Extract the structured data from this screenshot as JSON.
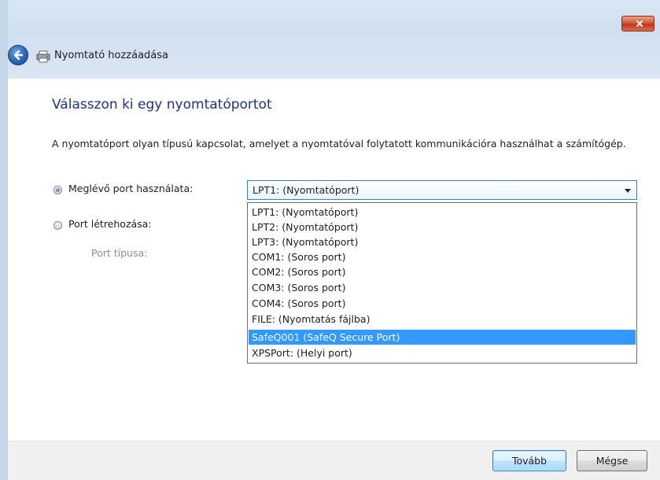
{
  "window": {
    "title": "Nyomtató hozzáadása"
  },
  "page": {
    "heading": "Válasszon ki egy nyomtatóportot",
    "description": "A nyomtatóport olyan típusú kapcsolat, amelyet a nyomtatóval folytatott kommunikációra használhat a számítógép."
  },
  "options": {
    "existing_port": {
      "label": "Meglévő port használata:",
      "checked": true,
      "selected_value": "LPT1: (Nyomtatóport)"
    },
    "create_port": {
      "label": "Port létrehozása:",
      "checked": false,
      "port_type_label": "Port típusa:"
    }
  },
  "dropdown": {
    "items": [
      "LPT1: (Nyomtatóport)",
      "LPT2: (Nyomtatóport)",
      "LPT3: (Nyomtatóport)",
      "COM1: (Soros port)",
      "COM2: (Soros port)",
      "COM3: (Soros port)",
      "COM4: (Soros port)",
      "FILE: (Nyomtatás fájlba)",
      "SafeQ001 (SafeQ Secure Port)",
      "XPSPort: (Helyi port)"
    ],
    "highlighted_index": 8
  },
  "buttons": {
    "next": "Tovább",
    "cancel": "Mégse"
  },
  "icons": {
    "back": "back-arrow-icon",
    "printer": "printer-icon",
    "close": "close-icon"
  }
}
